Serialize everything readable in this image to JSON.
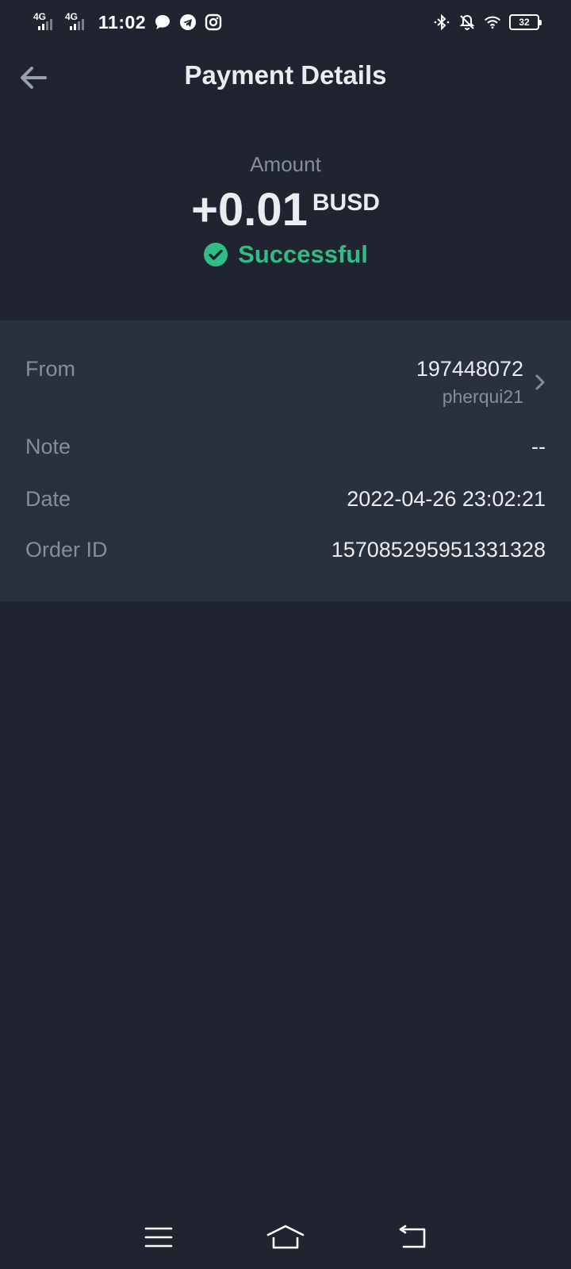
{
  "status_bar": {
    "network1": "4G",
    "network2": "4G",
    "time": "11:02",
    "battery": "32",
    "icons": [
      "chat-bubble-icon",
      "telegram-icon",
      "instagram-icon",
      "bluetooth-icon",
      "bell-off-icon",
      "wifi-icon",
      "battery-icon"
    ]
  },
  "header": {
    "title": "Payment Details",
    "back_icon": "arrow-left-icon"
  },
  "amount": {
    "label": "Amount",
    "value": "+0.01",
    "unit": "BUSD",
    "status": "Successful",
    "status_color": "#2ebd85"
  },
  "details": {
    "from_label": "From",
    "from_id": "197448072",
    "from_user": "pherqui21",
    "note_label": "Note",
    "note_value": "--",
    "date_label": "Date",
    "date_value": "2022-04-26 23:02:21",
    "order_label": "Order ID",
    "order_value": "157085295951331328"
  },
  "nav": {
    "icons": [
      "menu-icon",
      "home-icon",
      "back-nav-icon"
    ]
  },
  "colors": {
    "background": "#1f2430",
    "card": "#2a303d",
    "muted": "#848e9c",
    "text": "#eaecef",
    "success": "#2ebd85"
  }
}
